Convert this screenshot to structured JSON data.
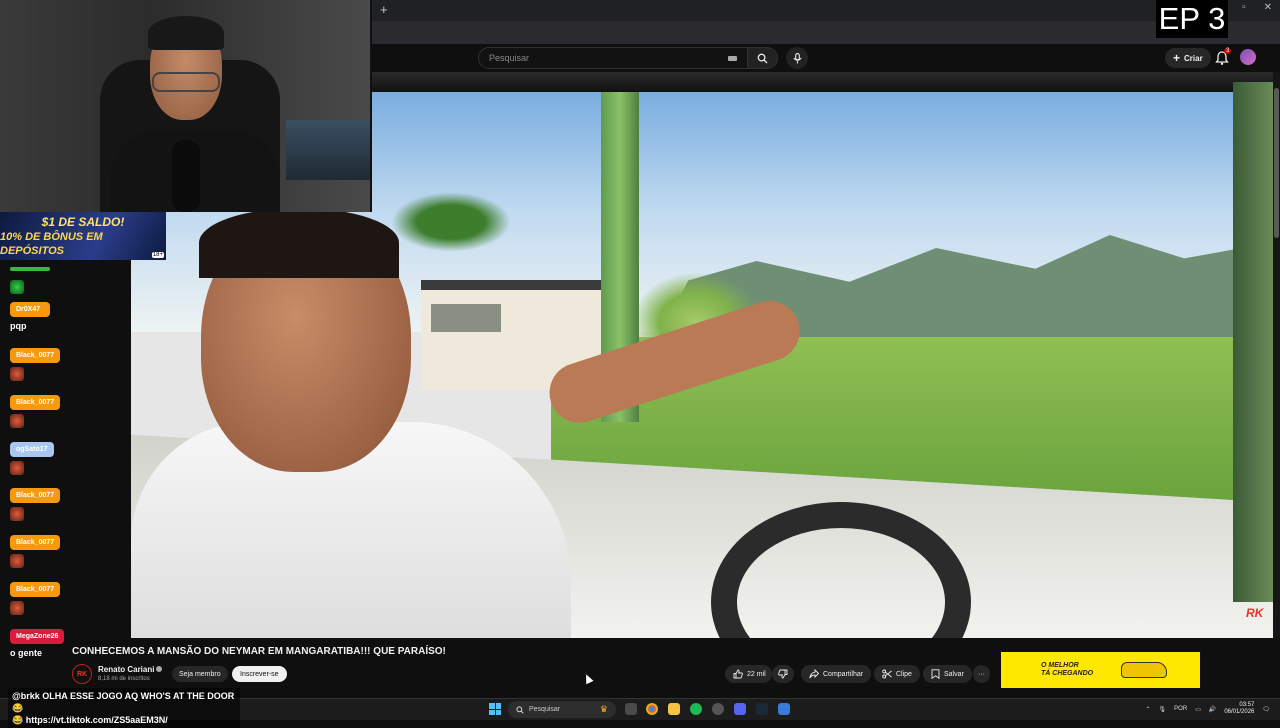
{
  "overlay": {
    "episode_label": "EP 3"
  },
  "promo": {
    "line1": "$1 DE SALDO!",
    "line2": "10% DE BÔNUS EM DEPÓSITOS",
    "age": "18+"
  },
  "browser": {
    "new_tab": "+",
    "minimize": "–",
    "restore": "▫",
    "close": "✕"
  },
  "youtube": {
    "search_placeholder": "Pesquisar",
    "create_label": "Criar",
    "notification_count": "3",
    "watermark": "RK"
  },
  "video": {
    "title": "CONHECEMOS A MANSÃO DO NEYMAR EM MANGARATIBA!!! QUE PARAÍSO!",
    "channel_name": "Renato Cariani",
    "channel_initials": "RK",
    "subscribers": "8,18 mi de inscritos",
    "member_label": "Seja membro",
    "subscribe_label": "Inscrever-se",
    "likes": "22 mil",
    "share_label": "Compartilhar",
    "clip_label": "Clipe",
    "save_label": "Salvar",
    "more_label": "···"
  },
  "ad": {
    "text_line1": "O MELHOR",
    "text_line2": "TÁ CHEGANDO"
  },
  "chat": {
    "messages": [
      {
        "user": "Dr0X47",
        "text": "pqp",
        "color": "#f59a0c"
      },
      {
        "user": "Black_0077",
        "text": "",
        "color": "#f59a0c"
      },
      {
        "user": "Black_0077",
        "text": "",
        "color": "#f59a0c"
      },
      {
        "user": "ogSato17",
        "text": "",
        "color": "#a9c7f0"
      },
      {
        "user": "Black_0077",
        "text": "",
        "color": "#f59a0c"
      },
      {
        "user": "Black_0077",
        "text": "",
        "color": "#f59a0c"
      },
      {
        "user": "Black_0077",
        "text": "",
        "color": "#f59a0c"
      },
      {
        "user": "MegaZone26",
        "text": "o gente",
        "color": "#d91c3c"
      }
    ],
    "bottom_line1": "@brkk OLHA ESSE JOGO AQ WHO'S AT THE DOOR😂",
    "bottom_line2": "😂 https://vt.tiktok.com/ZS5aaEM3N/"
  },
  "taskbar": {
    "search_label": "Pesquisar",
    "language": "POR",
    "time": "03:57",
    "date": "06/01/2026"
  },
  "colors": {
    "chat_orange": "#f59a0c",
    "chat_blue": "#a9c7f0",
    "chat_red": "#d91c3c",
    "ad_yellow": "#ffe800",
    "accent_red": "#cc0000"
  }
}
